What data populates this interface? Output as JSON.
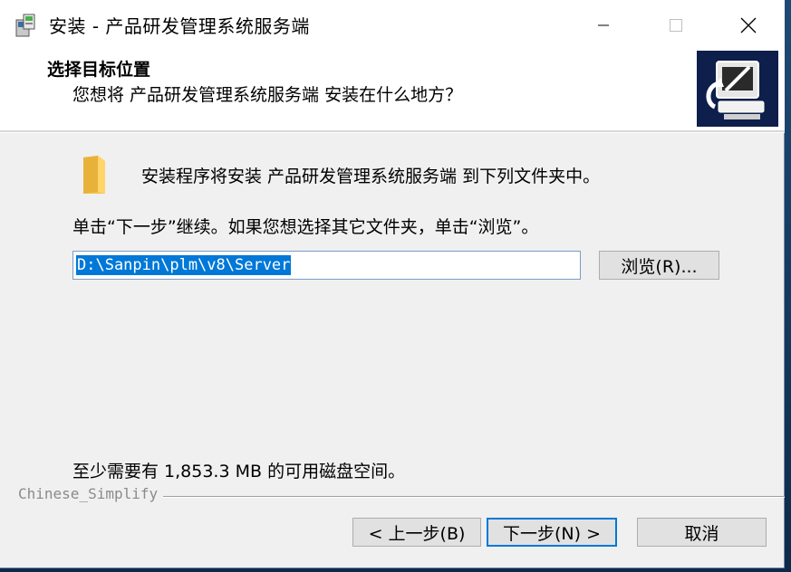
{
  "window": {
    "title": "安装 - 产品研发管理系统服务端",
    "icon": "installer-icon",
    "controls": [
      "minimize-icon",
      "maximize-icon",
      "close-icon"
    ]
  },
  "header": {
    "title": "选择目标位置",
    "subtitle": "您想将 产品研发管理系统服务端 安装在什么地方？",
    "image": "computer-install-icon"
  },
  "body": {
    "folder_icon": "folder-icon",
    "info_text": "安装程序将安装 产品研发管理系统服务端 到下列文件夹中。",
    "continue_text": "单击“下一步”继续。如果您想选择其它文件夹，单击“浏览”。",
    "path_value": "D:\\Sanpin\\plm\\v8\\Server",
    "browse_label": "浏览(R)...",
    "space_text": "至少需要有 1,853.3 MB 的可用磁盘空间。"
  },
  "footer": {
    "language_label": "Chinese_Simplify",
    "back_label": "< 上一步(B)",
    "next_label": "下一步(N) >",
    "cancel_label": "取消"
  },
  "colors": {
    "selection": "#0078d7",
    "header_bg": "#ffffff",
    "body_bg": "#f0f0f0"
  }
}
